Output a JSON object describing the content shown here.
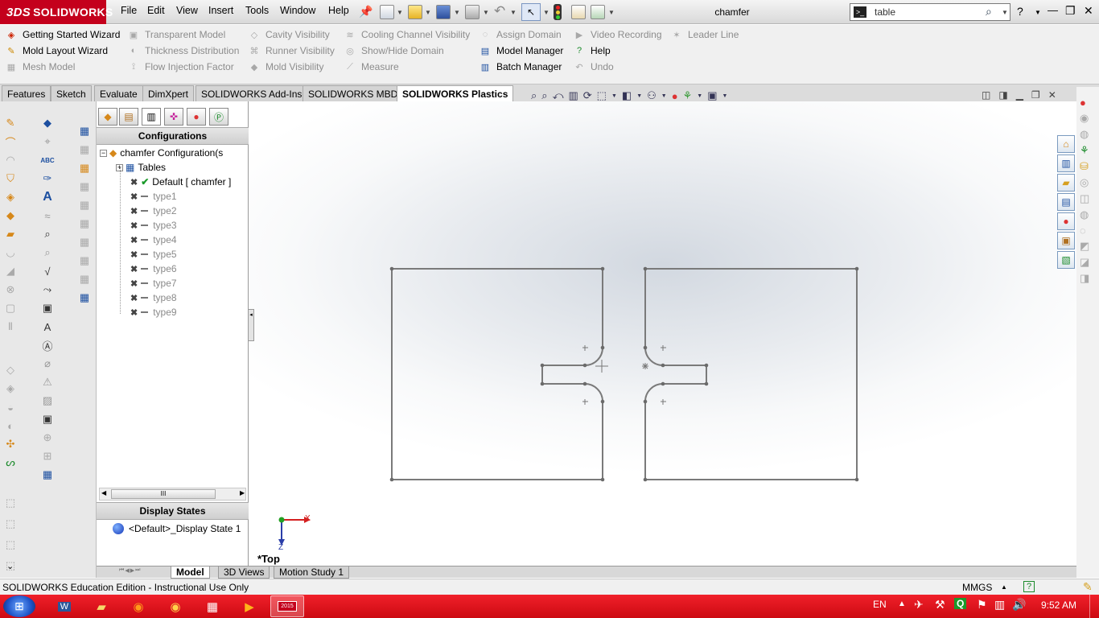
{
  "app": {
    "brand": "SOLIDWORKS",
    "brand_mark": "3DS",
    "doc_title": "chamfer"
  },
  "menu": [
    "File",
    "Edit",
    "View",
    "Insert",
    "Tools",
    "Window",
    "Help"
  ],
  "search": {
    "value": "table"
  },
  "window_controls": {
    "help": "?",
    "minimize": "—",
    "restore": "❐",
    "close": "✕"
  },
  "command_manager": {
    "col1": [
      {
        "label": "Getting Started Wizard",
        "enabled": true,
        "icon": "wizard-icon"
      },
      {
        "label": "Mold Layout Wizard",
        "enabled": true,
        "icon": "mold-wizard-icon"
      },
      {
        "label": "Mesh Model",
        "enabled": false,
        "icon": "mesh-icon"
      }
    ],
    "col2": [
      {
        "label": "Transparent Model",
        "enabled": false,
        "icon": "transparent-icon"
      },
      {
        "label": "Thickness Distribution",
        "enabled": false,
        "icon": "thickness-icon"
      },
      {
        "label": "Flow Injection Factor",
        "enabled": false,
        "icon": "flow-icon"
      }
    ],
    "col3": [
      {
        "label": "Cavity Visibility",
        "enabled": false,
        "icon": "cavity-icon"
      },
      {
        "label": "Runner Visibility",
        "enabled": false,
        "icon": "runner-icon"
      },
      {
        "label": "Mold Visibility",
        "enabled": false,
        "icon": "mold-icon"
      }
    ],
    "col4": [
      {
        "label": "Cooling Channel Visibility",
        "enabled": false,
        "icon": "cooling-icon"
      },
      {
        "label": "Show/Hide Domain",
        "enabled": false,
        "icon": "domain-icon"
      },
      {
        "label": "Measure",
        "enabled": false,
        "icon": "measure-icon"
      }
    ],
    "col5": [
      {
        "label": "Assign Domain",
        "enabled": false,
        "icon": "assign-icon"
      },
      {
        "label": "Model Manager",
        "enabled": true,
        "icon": "model-manager-icon"
      },
      {
        "label": "Batch Manager",
        "enabled": true,
        "icon": "batch-icon"
      }
    ],
    "col6": [
      {
        "label": "Video Recording",
        "enabled": false,
        "icon": "video-icon"
      },
      {
        "label": "Help",
        "enabled": true,
        "icon": "help-icon"
      },
      {
        "label": "Undo",
        "enabled": false,
        "icon": "undo-icon"
      }
    ],
    "col7": [
      {
        "label": "Leader Line",
        "enabled": false,
        "icon": "leader-icon"
      }
    ]
  },
  "tabs": [
    "Features",
    "Sketch",
    "Evaluate",
    "DimXpert",
    "SOLIDWORKS Add-Ins",
    "SOLIDWORKS MBD",
    "SOLIDWORKS Plastics"
  ],
  "active_tab": "SOLIDWORKS Plastics",
  "panel": {
    "configurations_header": "Configurations",
    "root": "chamfer Configuration(s",
    "tables": "Tables",
    "default": "Default [ chamfer ]",
    "configs": [
      "type1",
      "type2",
      "type3",
      "type4",
      "type5",
      "type6",
      "type7",
      "type8",
      "type9"
    ],
    "scroll_mark": "III",
    "display_states_header": "Display States",
    "display_state": "<Default>_Display State 1"
  },
  "viewport": {
    "view_name": "*Top",
    "axis_x": "X",
    "axis_z": "Z"
  },
  "bottom_tabs": [
    "Model",
    "3D Views",
    "Motion Study 1"
  ],
  "status": {
    "left": "SOLIDWORKS Education Edition - Instructional Use Only",
    "units": "MMGS",
    "help": "?"
  },
  "taskbar": {
    "lang": "EN",
    "time": "9:52 AM",
    "badge": "2015"
  },
  "colors": {
    "brand": "#c4001c",
    "taskbar": "#e0141c",
    "sketch_line": "#7a7a7a"
  }
}
